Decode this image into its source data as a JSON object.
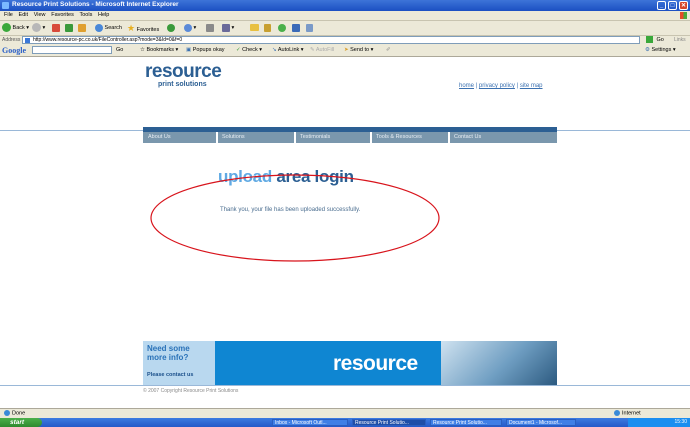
{
  "window": {
    "title": "Resource Print Solutions - Microsoft Internet Explorer",
    "controls": {
      "min": "_",
      "max": "□",
      "close": "✕"
    }
  },
  "menu": [
    "File",
    "Edit",
    "View",
    "Favorites",
    "Tools",
    "Help"
  ],
  "toolbar": {
    "back": "Back",
    "search": "Search",
    "favorites": "Favorites"
  },
  "address": {
    "label": "Address",
    "url": "http://www.resource-pc.co.uk/FileController.asp?mode=3&Id=0&f=0",
    "go": "Go",
    "links": "Links"
  },
  "google_bar": {
    "logo": "Google",
    "go": "Go",
    "bookmarks": "Bookmarks",
    "popups": "Popups okay",
    "check": "Check",
    "autolink": "AutoLink",
    "autofill": "AutoFill",
    "sendto": "Send to",
    "settings": "Settings"
  },
  "site": {
    "logo": "resource",
    "logo_sub": "print solutions",
    "top_links": [
      "home",
      "privacy policy",
      "site map"
    ],
    "nav": [
      "About Us",
      "Solutions",
      "Testimonials",
      "Tools & Resources",
      "Contact Us"
    ],
    "heading_part1": "upload",
    "heading_part2": "area login",
    "message": "Thank you, your file has been uploaded successfully.",
    "annotation_color": "#d8141c",
    "banner": {
      "need_line1": "Need some",
      "need_line2": "more info?",
      "contact": "Please contact us",
      "wordmark": "resource"
    },
    "copyright": "© 2007 Copyright Resource Print Solutions"
  },
  "status": {
    "text": "Done",
    "zone": "Internet"
  },
  "taskbar": {
    "start": "start",
    "windows": [
      "Inbox - Microsoft Outl...",
      "Resource Print Solutio...",
      "Resource Print Solutio...",
      "Document1 - Microsof..."
    ],
    "time": "15:30"
  }
}
